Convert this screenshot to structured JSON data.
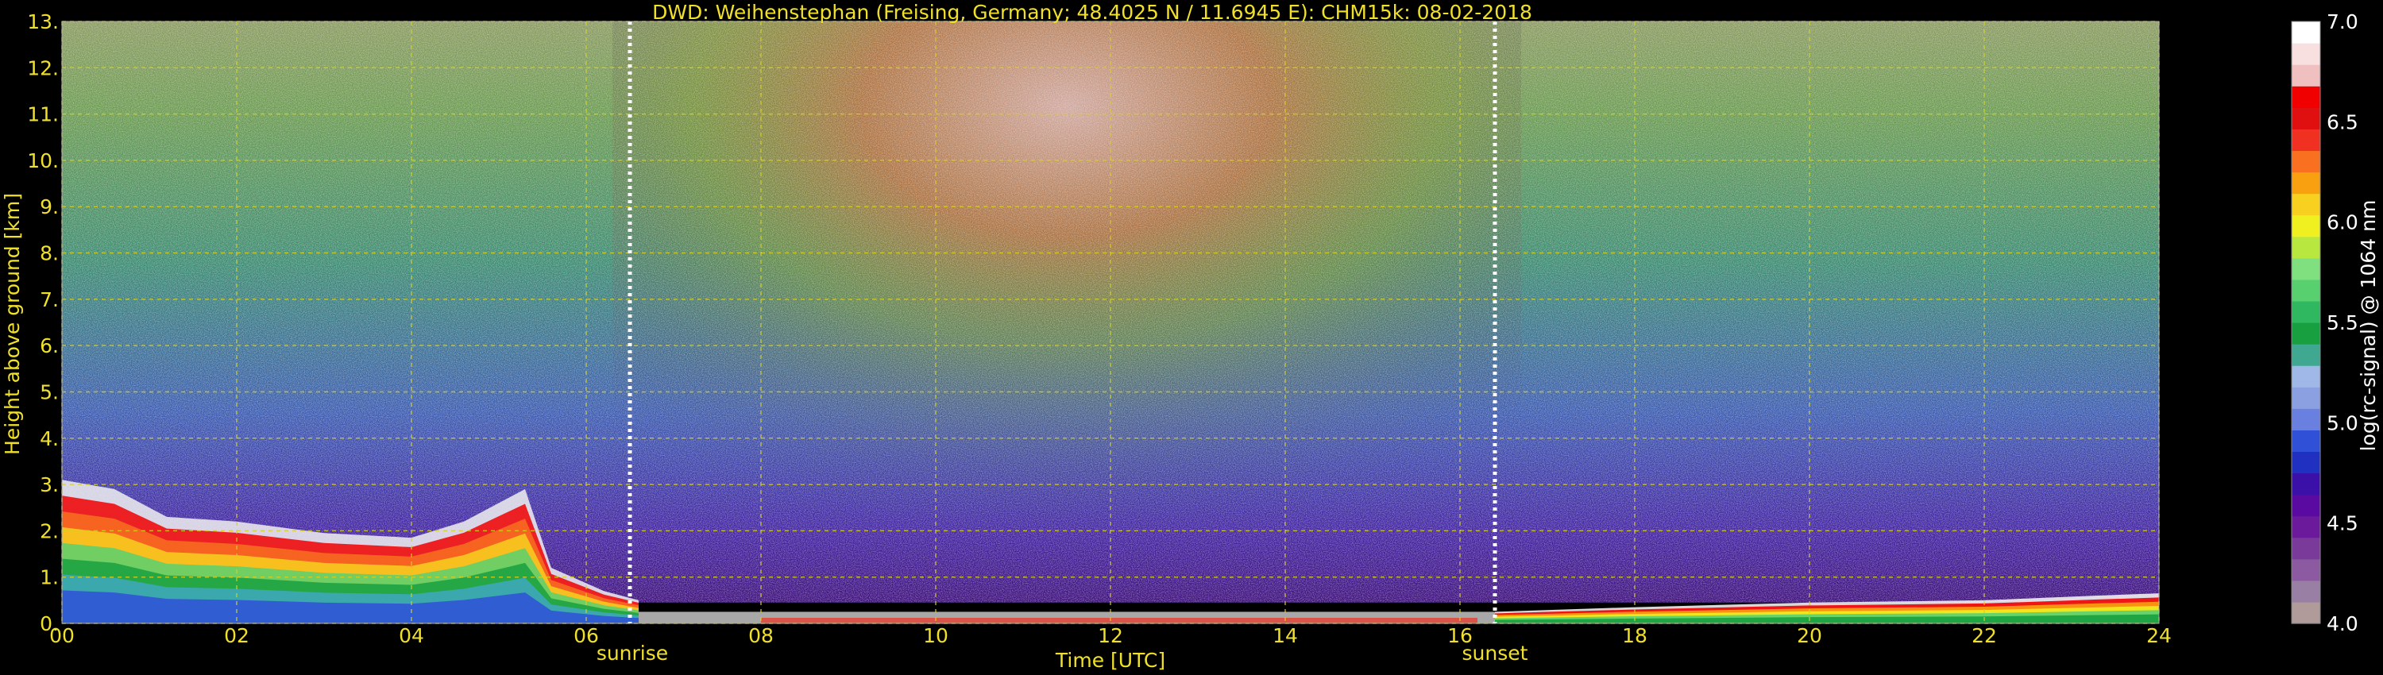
{
  "chart_data": {
    "type": "heatmap",
    "title": "DWD: Weihenstephan (Freising, Germany; 48.4025 N / 11.6945 E):    CHM15k: 08-02-2018",
    "xlabel": "Time [UTC]",
    "ylabel": "Height above ground [km]",
    "xlim": [
      0,
      24
    ],
    "ylim": [
      0,
      13
    ],
    "x_ticks": [
      "00",
      "02",
      "04",
      "06",
      "08",
      "10",
      "12",
      "14",
      "16",
      "18",
      "20",
      "22",
      "24"
    ],
    "y_ticks": [
      "0.",
      "1.",
      "2.",
      "3.",
      "4.",
      "5.",
      "6.",
      "7.",
      "8.",
      "9.",
      "10.",
      "11.",
      "12.",
      "13."
    ],
    "grid": true,
    "annotations": [
      {
        "label": "sunrise",
        "x": 6.5
      },
      {
        "label": "sunset",
        "x": 16.4
      }
    ],
    "colorbar": {
      "label": "log(rc-signal) @ 1064 nm",
      "range": [
        4.0,
        7.0
      ],
      "ticks": [
        "4.0",
        "4.5",
        "5.0",
        "5.5",
        "6.0",
        "6.5",
        "7.0"
      ]
    }
  },
  "colors": {
    "text": "#f0e02a",
    "grid": "#d8d020",
    "sun_line": "#ffffff",
    "colormap": [
      "#b09a9a",
      "#9a7fa5",
      "#8c5aa0",
      "#7a3a9a",
      "#6a1a9a",
      "#5a0aa0",
      "#3a10a8",
      "#2030c0",
      "#3050d8",
      "#6a80e0",
      "#8aa0e0",
      "#a0b8e8",
      "#40a890",
      "#18a040",
      "#30b860",
      "#58d070",
      "#80e080",
      "#b8e840",
      "#f0f020",
      "#f8d020",
      "#f8a010",
      "#f87020",
      "#f03020",
      "#e01010",
      "#f00000",
      "#f0c0c0",
      "#f8e0e0",
      "#ffffff"
    ]
  }
}
